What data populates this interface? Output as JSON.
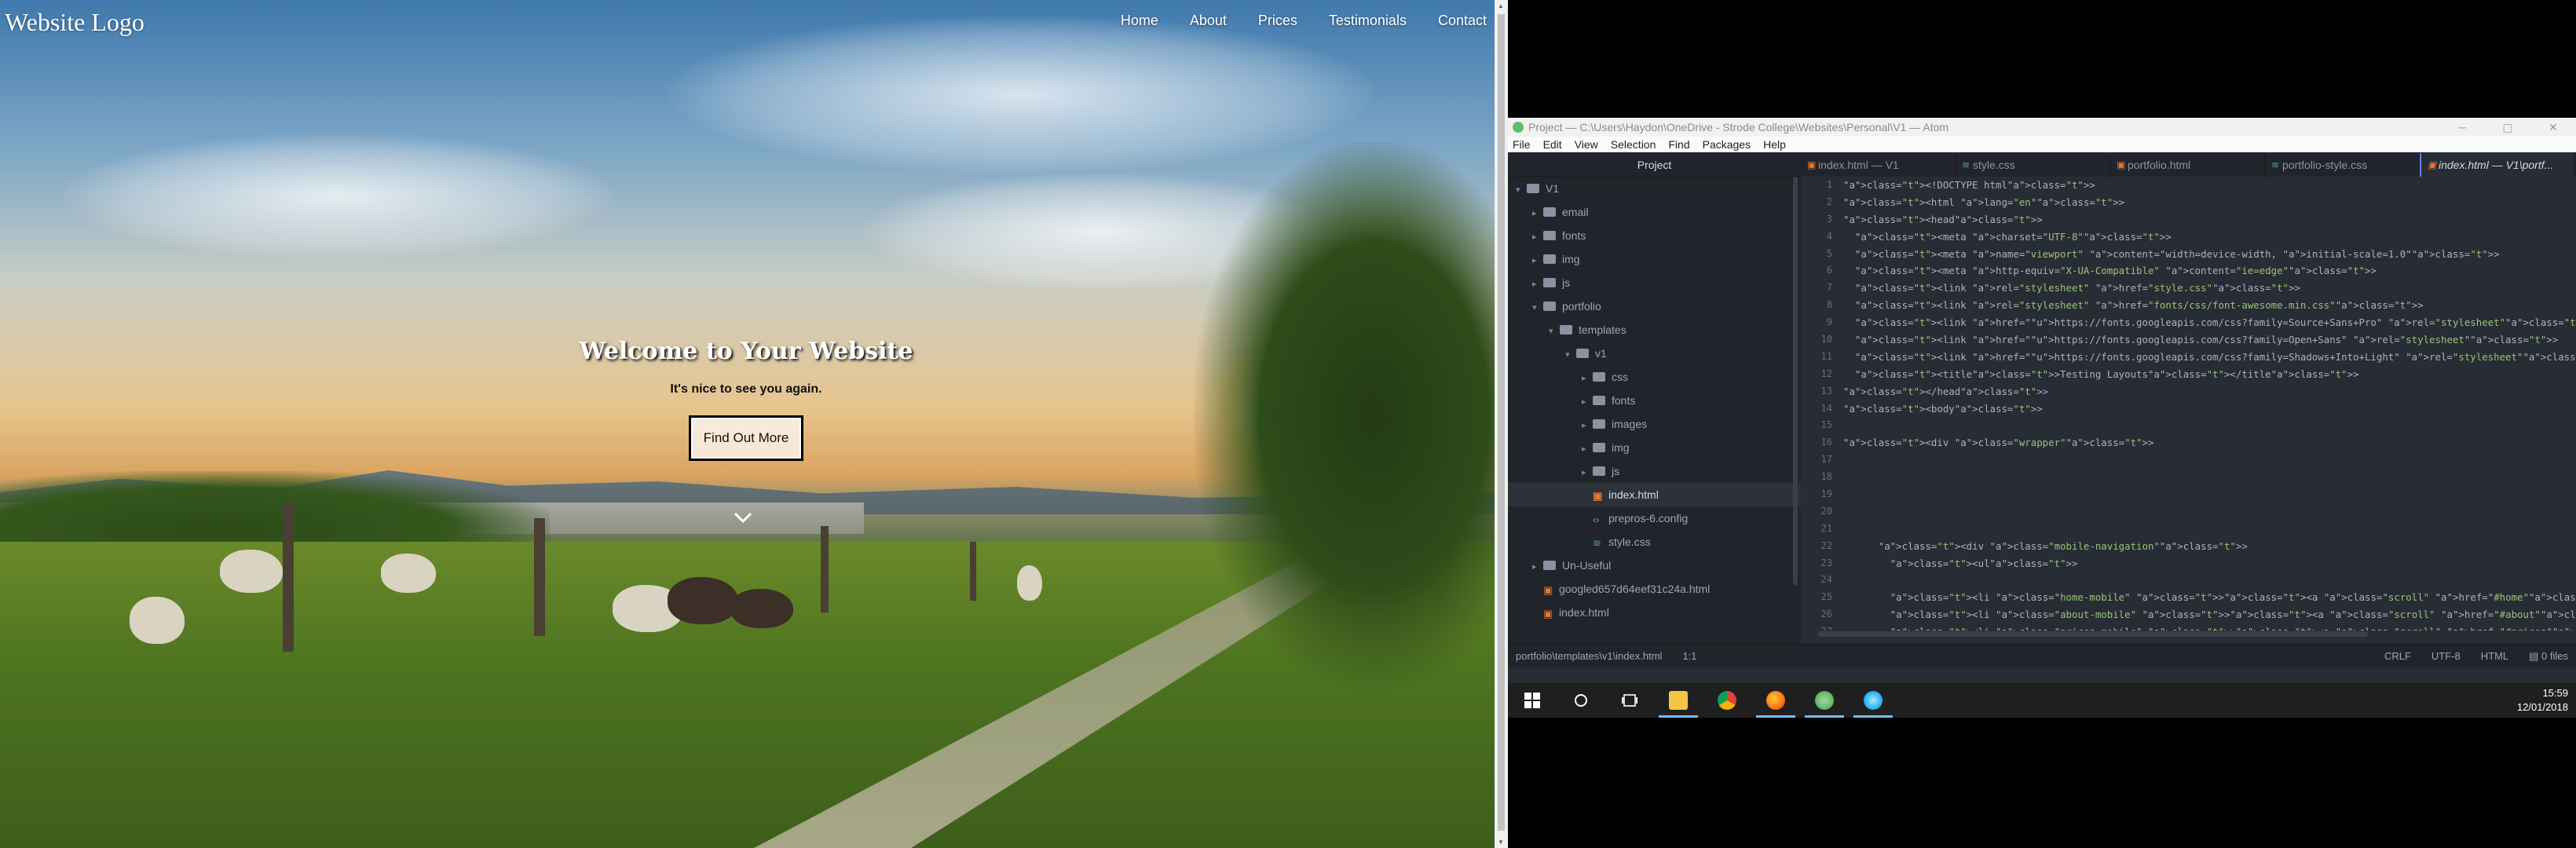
{
  "website": {
    "logo": "Website Logo",
    "nav": [
      "Home",
      "About",
      "Prices",
      "Testimonials",
      "Contact"
    ],
    "hero": {
      "heading": "Welcome to Your Website",
      "subheading": "It's nice to see you again.",
      "button": "Find Out More"
    }
  },
  "atom": {
    "window_title": "Project — C:\\Users\\Haydon\\OneDrive - Strode College\\Websites\\Personal\\V1 — Atom",
    "menu": [
      "File",
      "Edit",
      "View",
      "Selection",
      "Find",
      "Packages",
      "Help"
    ],
    "tree_header": "Project",
    "tree": [
      {
        "label": "V1",
        "indent": 0,
        "caret": "▾",
        "icon": "folder"
      },
      {
        "label": "email",
        "indent": 1,
        "caret": "▸",
        "icon": "folder"
      },
      {
        "label": "fonts",
        "indent": 1,
        "caret": "▸",
        "icon": "folder"
      },
      {
        "label": "img",
        "indent": 1,
        "caret": "▸",
        "icon": "folder"
      },
      {
        "label": "js",
        "indent": 1,
        "caret": "▸",
        "icon": "folder"
      },
      {
        "label": "portfolio",
        "indent": 1,
        "caret": "▾",
        "icon": "folder"
      },
      {
        "label": "templates",
        "indent": 2,
        "caret": "▾",
        "icon": "folder"
      },
      {
        "label": "v1",
        "indent": 3,
        "caret": "▾",
        "icon": "folder"
      },
      {
        "label": "css",
        "indent": 4,
        "caret": "▸",
        "icon": "folder"
      },
      {
        "label": "fonts",
        "indent": 4,
        "caret": "▸",
        "icon": "folder"
      },
      {
        "label": "images",
        "indent": 4,
        "caret": "▸",
        "icon": "folder"
      },
      {
        "label": "img",
        "indent": 4,
        "caret": "▸",
        "icon": "folder"
      },
      {
        "label": "js",
        "indent": 4,
        "caret": "▸",
        "icon": "folder"
      },
      {
        "label": "index.html",
        "indent": 4,
        "caret": "",
        "icon": "file-html",
        "selected": true
      },
      {
        "label": "prepros-6.config",
        "indent": 4,
        "caret": "",
        "icon": "file-cfg"
      },
      {
        "label": "style.css",
        "indent": 4,
        "caret": "",
        "icon": "file-css"
      },
      {
        "label": "Un-Useful",
        "indent": 1,
        "caret": "▸",
        "icon": "folder"
      },
      {
        "label": "googled657d64eef31c24a.html",
        "indent": 1,
        "caret": "",
        "icon": "file-gen"
      },
      {
        "label": "index.html",
        "indent": 1,
        "caret": "",
        "icon": "file-gen"
      }
    ],
    "tabs": [
      {
        "label": "index.html — V1",
        "icon": "h",
        "active": false
      },
      {
        "label": "style.css",
        "icon": "c",
        "active": false
      },
      {
        "label": "portfolio.html",
        "icon": "h",
        "active": false
      },
      {
        "label": "portfolio-style.css",
        "icon": "c",
        "active": false
      },
      {
        "label": "index.html — V1\\portf...",
        "icon": "h",
        "active": true
      }
    ],
    "code_lines": [
      "<!DOCTYPE html>",
      "<html lang=\"en\">",
      "<head>",
      "  <meta charset=\"UTF-8\">",
      "  <meta name=\"viewport\" content=\"width=device-width, initial-scale=1.0\">",
      "  <meta http-equiv=\"X-UA-Compatible\" content=\"ie=edge\">",
      "  <link rel=\"stylesheet\" href=\"style.css\">",
      "  <link rel=\"stylesheet\" href=\"fonts/css/font-awesome.min.css\">",
      "  <link href=\"https://fonts.googleapis.com/css?family=Source+Sans+Pro\" rel=\"stylesheet\">",
      "  <link href=\"https://fonts.googleapis.com/css?family=Open+Sans\" rel=\"stylesheet\">",
      "  <link href=\"https://fonts.googleapis.com/css?family=Shadows+Into+Light\" rel=\"stylesheet\">",
      "  <title>Testing Layouts</title>",
      "</head>",
      "<body>",
      "",
      "<div class=\"wrapper\">",
      "",
      "",
      "",
      "",
      "",
      "      <div class=\"mobile-navigation\">",
      "        <ul>",
      "",
      "        <li class=\"home-mobile\" ><a class=\"scroll\" href=\"#home\">Home</a></li>",
      "        <li class=\"about-mobile\" ><a class=\"scroll\" href=\"#about\"></i>About</a></li>",
      "        <li class=\"prices-mobile\" ><a class=\"scroll\" href=\"#prices\"></i>Prices</a></li>"
    ],
    "status": {
      "path": "portfolio\\templates\\v1\\index.html",
      "cursor": "1:1",
      "line_ending": "CRLF",
      "encoding": "UTF-8",
      "grammar": "HTML",
      "files": "0 files"
    }
  },
  "taskbar": {
    "apps": [
      {
        "name": "start",
        "color": "#ffffff"
      },
      {
        "name": "search",
        "color": "#ffffff"
      },
      {
        "name": "task-view",
        "color": "#ffffff"
      },
      {
        "name": "file-explorer",
        "color": "#f6c445"
      },
      {
        "name": "chrome",
        "color": "#4caf50"
      },
      {
        "name": "firefox",
        "color": "#ff7a1a"
      },
      {
        "name": "atom",
        "color": "#66bb6a"
      },
      {
        "name": "app",
        "color": "#29b6f6"
      }
    ],
    "time": "15:59",
    "date": "12/01/2018"
  }
}
